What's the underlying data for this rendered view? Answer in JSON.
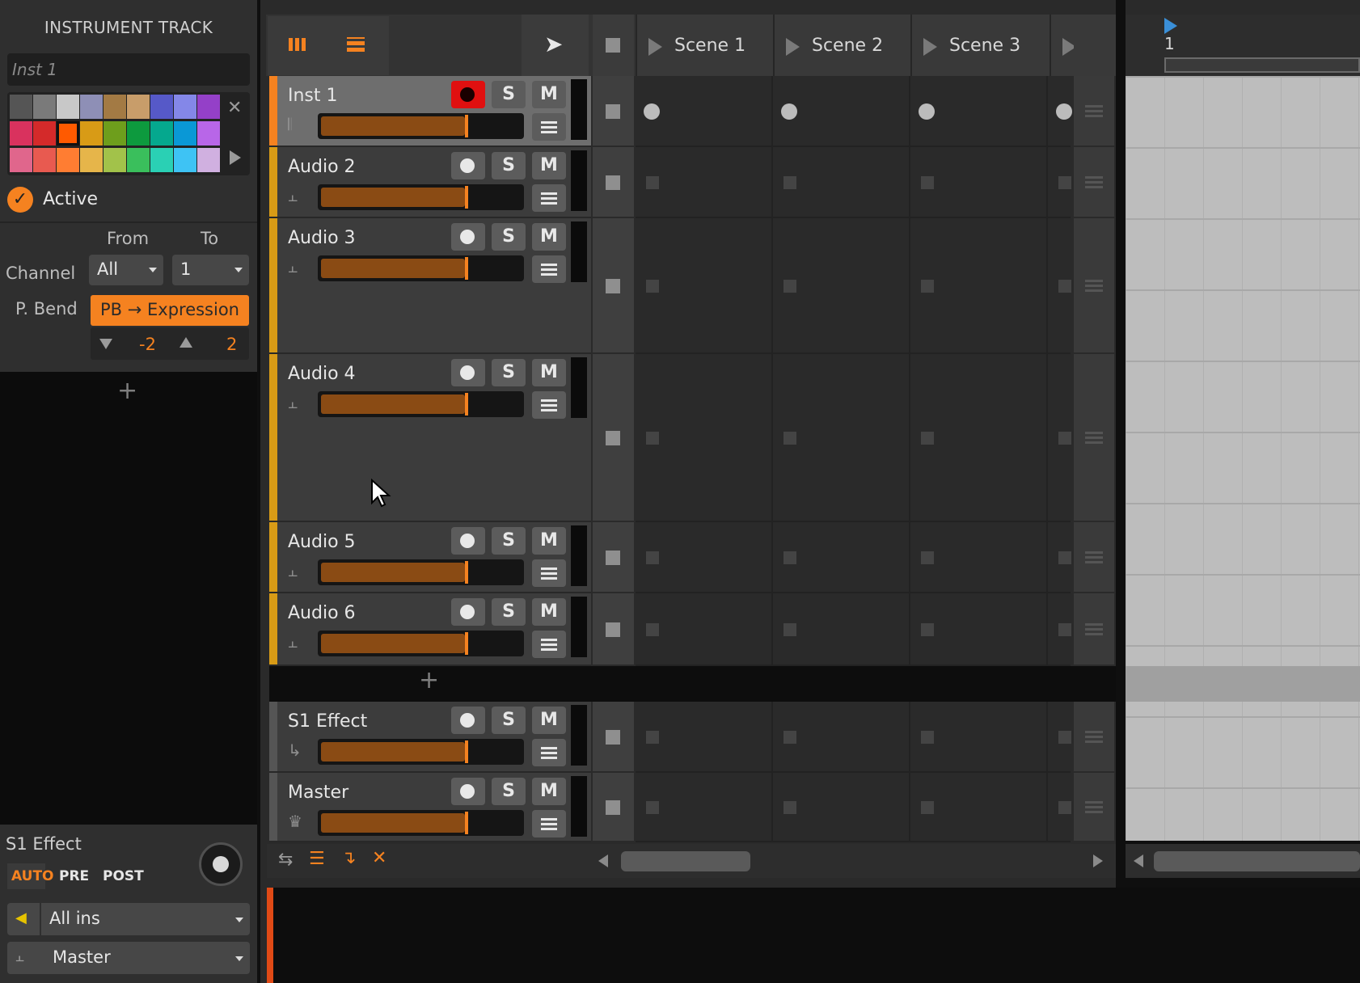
{
  "inspector": {
    "title": "INSTRUMENT TRACK",
    "name_placeholder": "Inst 1",
    "active_label": "Active",
    "from_label": "From",
    "to_label": "To",
    "channel_label": "Channel",
    "channel_from": "All",
    "channel_to": "1",
    "pbend_label": "P. Bend",
    "pbend_mode": "PB → Expression",
    "pb_down": "-2",
    "pb_up": "2",
    "send_name": "S1 Effect",
    "auto_label": "AUTO",
    "pre_label": "PRE",
    "post_label": "POST",
    "input": "All ins",
    "output": "Master",
    "accent_color": "#f58220"
  },
  "scenes": [
    "Scene 1",
    "Scene 2",
    "Scene 3"
  ],
  "tracks": [
    {
      "name": "Inst 1",
      "solo": "S",
      "mute": "M",
      "armed": true,
      "selected": true,
      "fader": 0.72
    },
    {
      "name": "Audio 2",
      "solo": "S",
      "mute": "M",
      "armed": false,
      "fader": 0.72
    },
    {
      "name": "Audio 3",
      "solo": "S",
      "mute": "M",
      "armed": false,
      "fader": 0.72
    },
    {
      "name": "Audio 4",
      "solo": "S",
      "mute": "M",
      "armed": false,
      "fader": 0.72
    },
    {
      "name": "Audio 5",
      "solo": "S",
      "mute": "M",
      "armed": false,
      "fader": 0.72
    },
    {
      "name": "Audio 6",
      "solo": "S",
      "mute": "M",
      "armed": false,
      "fader": 0.72
    },
    {
      "name": "S1 Effect",
      "solo": "S",
      "mute": "M",
      "armed": false,
      "fader": 0.72
    },
    {
      "name": "Master",
      "solo": "S",
      "mute": "M",
      "armed": false,
      "fader": 0.72
    }
  ],
  "arranger": {
    "bar_label": "1"
  },
  "icons": {
    "close": "close-icon",
    "play": "scene-play-icon",
    "record": "record-icon",
    "menu": "menu-icon"
  }
}
